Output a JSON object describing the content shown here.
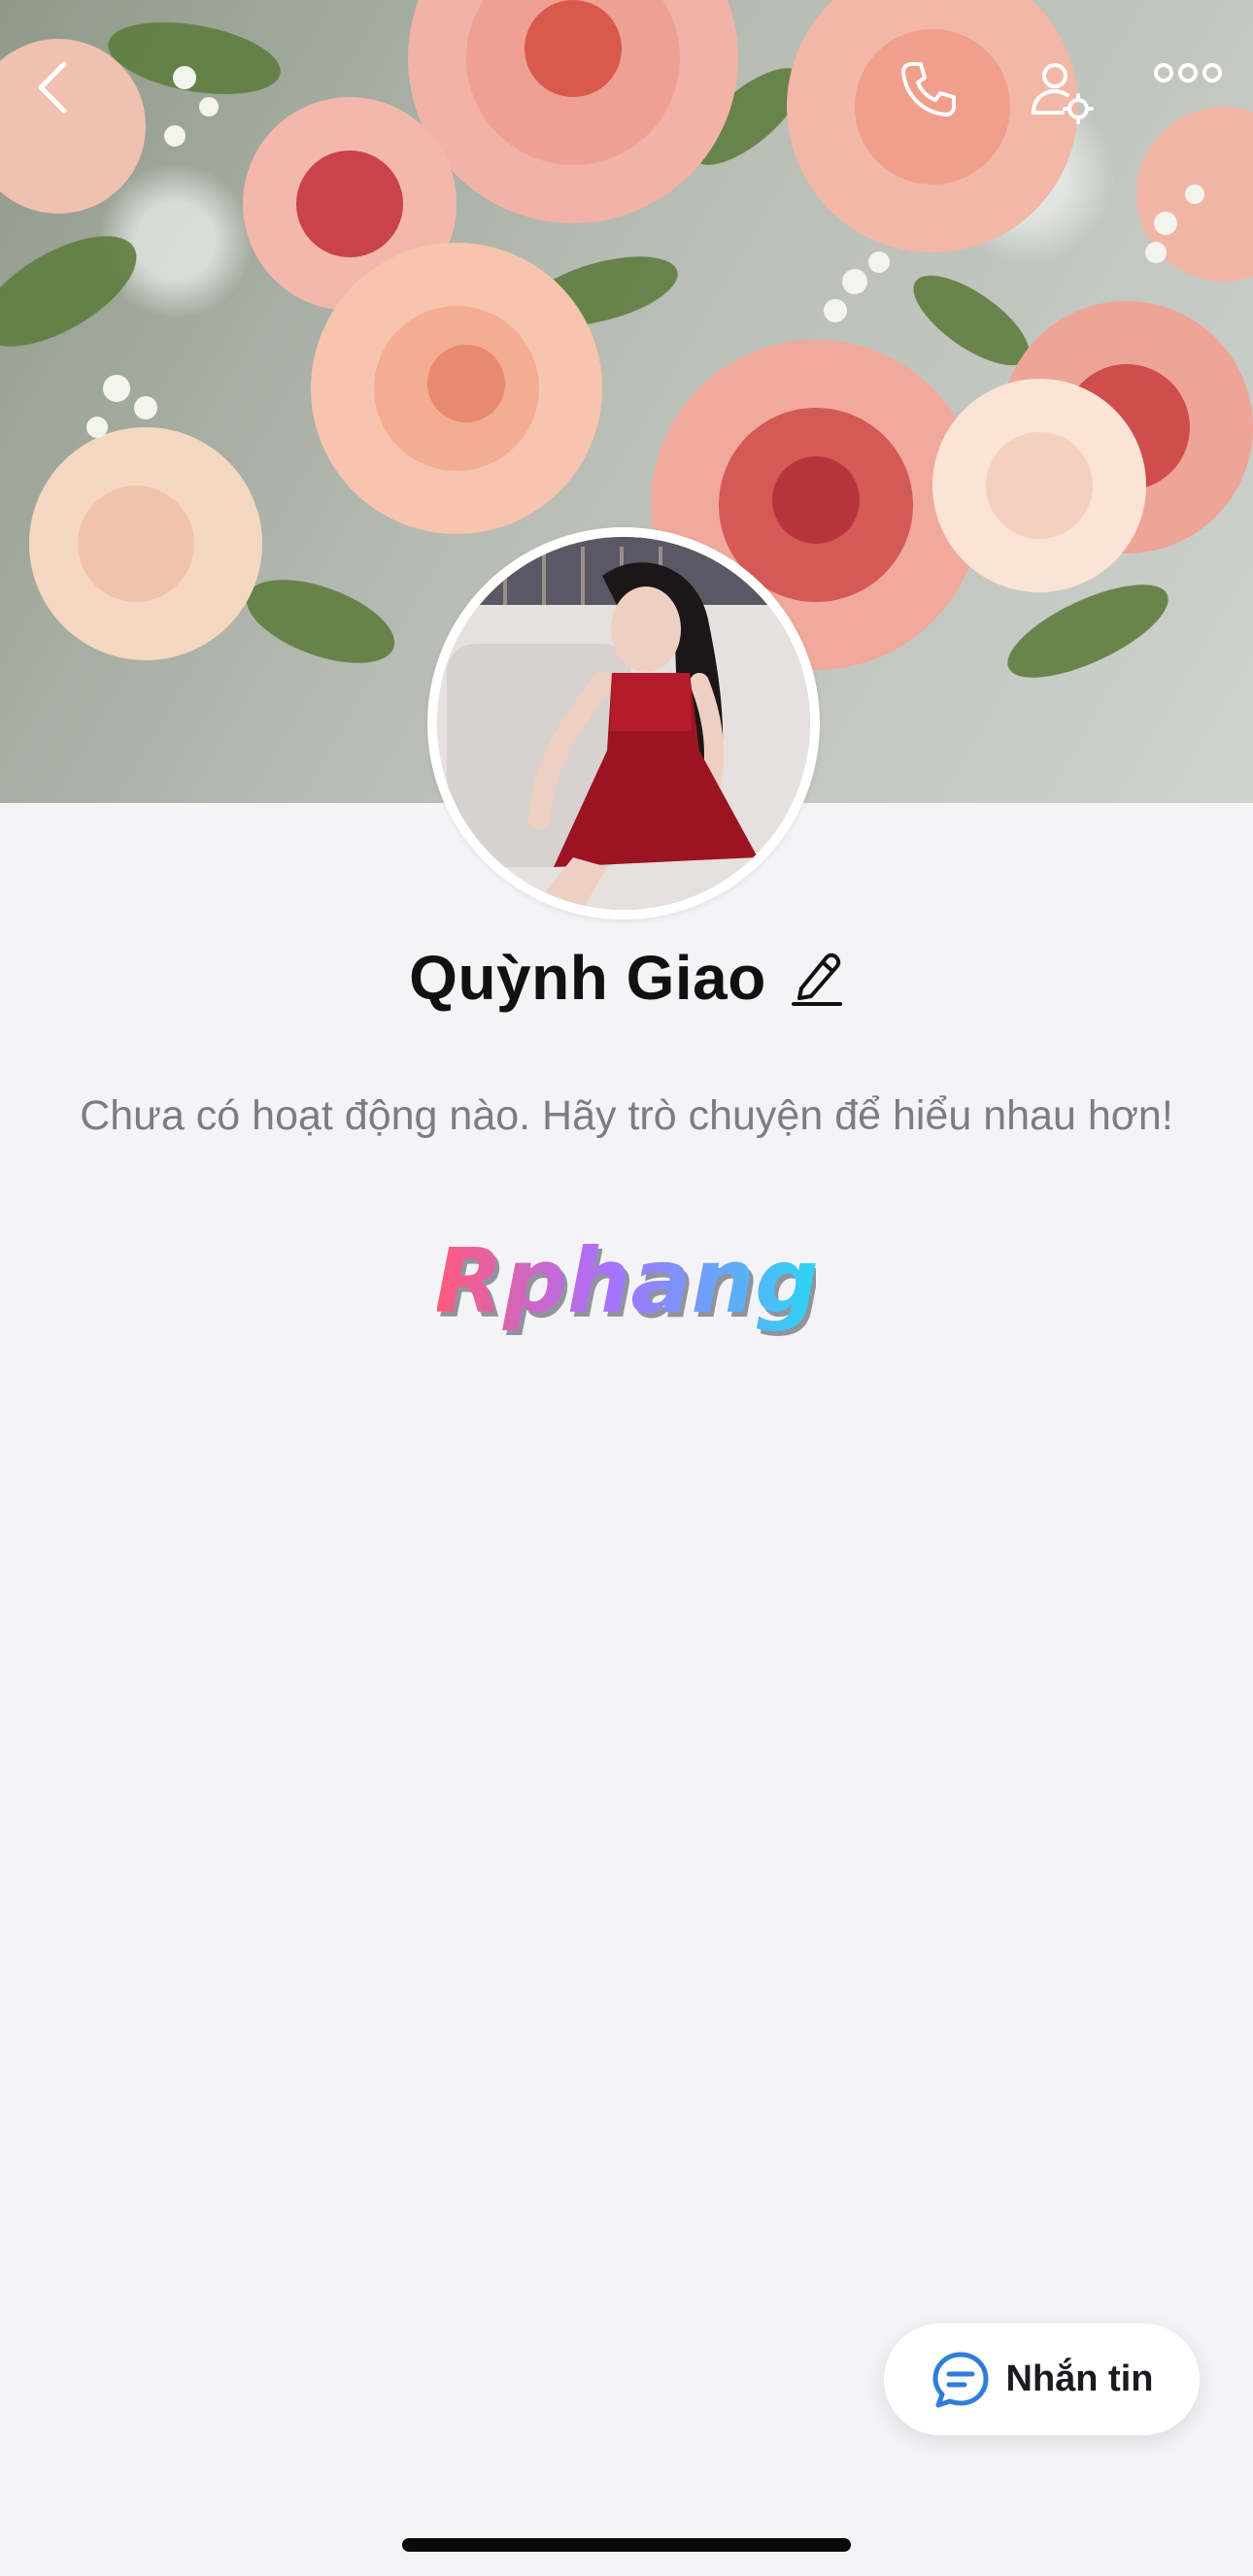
{
  "profile": {
    "name": "Quỳnh Giao",
    "empty_activity": "Chưa có hoạt động nào. Hãy trò chuyện để hiểu nhau hơn!",
    "brand_text": "Rphang"
  },
  "header": {
    "icons": [
      "chevron-left-icon",
      "phone-icon",
      "user-settings-icon",
      "more-icon"
    ]
  },
  "actions": {
    "message_label": "Nhắn tin"
  },
  "colors": {
    "background": "#f4f4f7",
    "message_icon": "#2f7ddb",
    "brand_gradient_start": "#ff5a78",
    "brand_gradient_end": "#2bd6f2"
  }
}
